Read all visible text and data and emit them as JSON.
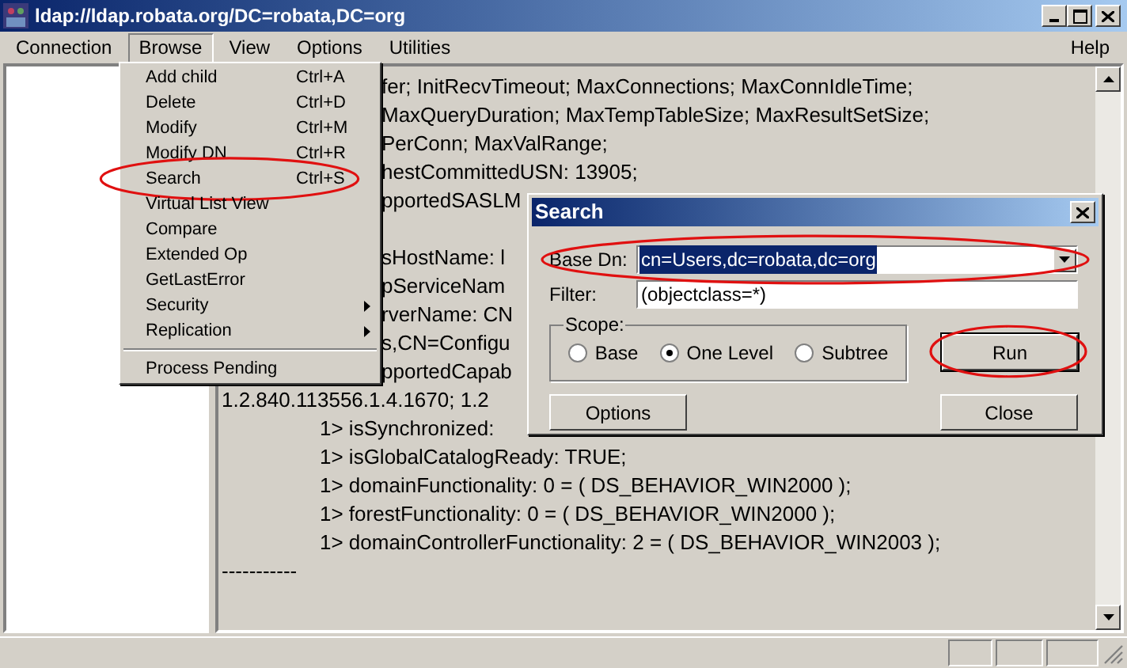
{
  "window": {
    "title": "ldap://ldap.robata.org/DC=robata,DC=org"
  },
  "menu_bar": {
    "items": [
      {
        "label": "Connection",
        "selected": false
      },
      {
        "label": "Browse",
        "selected": true
      },
      {
        "label": "View",
        "selected": false
      },
      {
        "label": "Options",
        "selected": false
      },
      {
        "label": "Utilities",
        "selected": false
      }
    ],
    "help": "Help"
  },
  "browse_menu": {
    "items": [
      {
        "kind": "item",
        "label": "Add child",
        "shortcut": "Ctrl+A",
        "circled": false
      },
      {
        "kind": "item",
        "label": "Delete",
        "shortcut": "Ctrl+D",
        "circled": false
      },
      {
        "kind": "item",
        "label": "Modify",
        "shortcut": "Ctrl+M",
        "circled": false
      },
      {
        "kind": "item",
        "label": "Modify DN",
        "shortcut": "Ctrl+R",
        "circled": false
      },
      {
        "kind": "item",
        "label": "Search",
        "shortcut": "Ctrl+S",
        "circled": true
      },
      {
        "kind": "item",
        "label": "Virtual List View",
        "circled": false
      },
      {
        "kind": "item",
        "label": "Compare",
        "circled": false
      },
      {
        "kind": "item",
        "label": "Extended Op",
        "circled": false
      },
      {
        "kind": "item",
        "label": "GetLastError",
        "circled": false
      },
      {
        "kind": "submenu",
        "label": "Security",
        "circled": false
      },
      {
        "kind": "submenu",
        "label": "Replication",
        "circled": false
      },
      {
        "kind": "separator"
      },
      {
        "kind": "item",
        "label": "Process Pending",
        "circled": false
      }
    ]
  },
  "output": {
    "lines": [
      {
        "kind": "behind_menu",
        "text": "fer; InitRecvTimeout; MaxConnections; MaxConnIdleTime;"
      },
      {
        "kind": "behind_menu",
        "text": "MaxQueryDuration; MaxTempTableSize; MaxResultSetSize;"
      },
      {
        "kind": "behind_menu",
        "text": "PerConn; MaxValRange;"
      },
      {
        "kind": "behind_menu",
        "text": "hestCommittedUSN: 13905;"
      },
      {
        "kind": "behind_menu",
        "text": "pportedSASLM"
      },
      {
        "kind": "blank"
      },
      {
        "kind": "behind_menu",
        "text": "sHostName: l"
      },
      {
        "kind": "behind_menu",
        "text": "pServiceNam"
      },
      {
        "kind": "behind_menu",
        "text": "rverName: CN"
      },
      {
        "kind": "behind_menu",
        "text": "s,CN=Configu"
      },
      {
        "kind": "behind_menu",
        "text": "pportedCapab"
      },
      {
        "kind": "full",
        "text": "1.2.840.113556.1.4.1670; 1.2"
      },
      {
        "kind": "indented",
        "text": "1> isSynchronized:"
      },
      {
        "kind": "indented",
        "text": "1> isGlobalCatalogReady: TRUE;"
      },
      {
        "kind": "indented",
        "text": "1> domainFunctionality: 0 = ( DS_BEHAVIOR_WIN2000 );"
      },
      {
        "kind": "indented",
        "text": "1> forestFunctionality: 0 = ( DS_BEHAVIOR_WIN2000 );"
      },
      {
        "kind": "indented",
        "text": "1> domainControllerFunctionality: 2 = ( DS_BEHAVIOR_WIN2003 );"
      },
      {
        "kind": "full",
        "text": "-----------"
      }
    ]
  },
  "search_dialog": {
    "title": "Search",
    "base_dn": {
      "label": "Base Dn:",
      "value": "cn=Users,dc=robata,dc=org",
      "circled": true
    },
    "filter": {
      "label": "Filter:",
      "value": "(objectclass=*)"
    },
    "scope": {
      "label": "Scope:",
      "options": [
        {
          "label": "Base",
          "selected": false
        },
        {
          "label": "One Level",
          "selected": true
        },
        {
          "label": "Subtree",
          "selected": false
        }
      ]
    },
    "run_button": {
      "label": "Run",
      "circled": true
    },
    "options_button": {
      "label": "Options"
    },
    "close_button": {
      "label": "Close"
    }
  }
}
